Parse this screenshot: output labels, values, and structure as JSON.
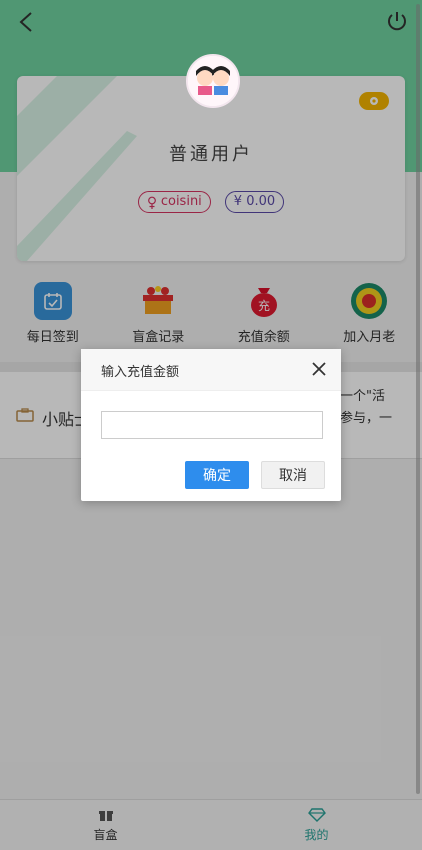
{
  "user": {
    "name": "普通用户",
    "gender_tag": "coisini",
    "balance_tag": "¥ 0.00"
  },
  "features": [
    {
      "label": "每日签到",
      "icon": "calendar-icon"
    },
    {
      "label": "盲盒记录",
      "icon": "gift-box-icon"
    },
    {
      "label": "充值余额",
      "icon": "money-bag-icon"
    },
    {
      "label": "加入月老",
      "icon": "matchmaker-badge-icon"
    }
  ],
  "tips": {
    "title": "小贴士",
    "text": "一个\"活\n参与，一"
  },
  "dialog": {
    "title": "输入充值金额",
    "input_value": "",
    "input_placeholder": "",
    "ok_label": "确定",
    "cancel_label": "取消"
  },
  "tabbar": {
    "tabs": [
      {
        "label": "盲盒",
        "icon": "gift-icon",
        "active": false
      },
      {
        "label": "我的",
        "icon": "diamond-icon",
        "active": true
      }
    ]
  },
  "colors": {
    "brand_green": "#6fd2a0",
    "active_tab": "#2aa198",
    "primary_button": "#2e8ded"
  }
}
